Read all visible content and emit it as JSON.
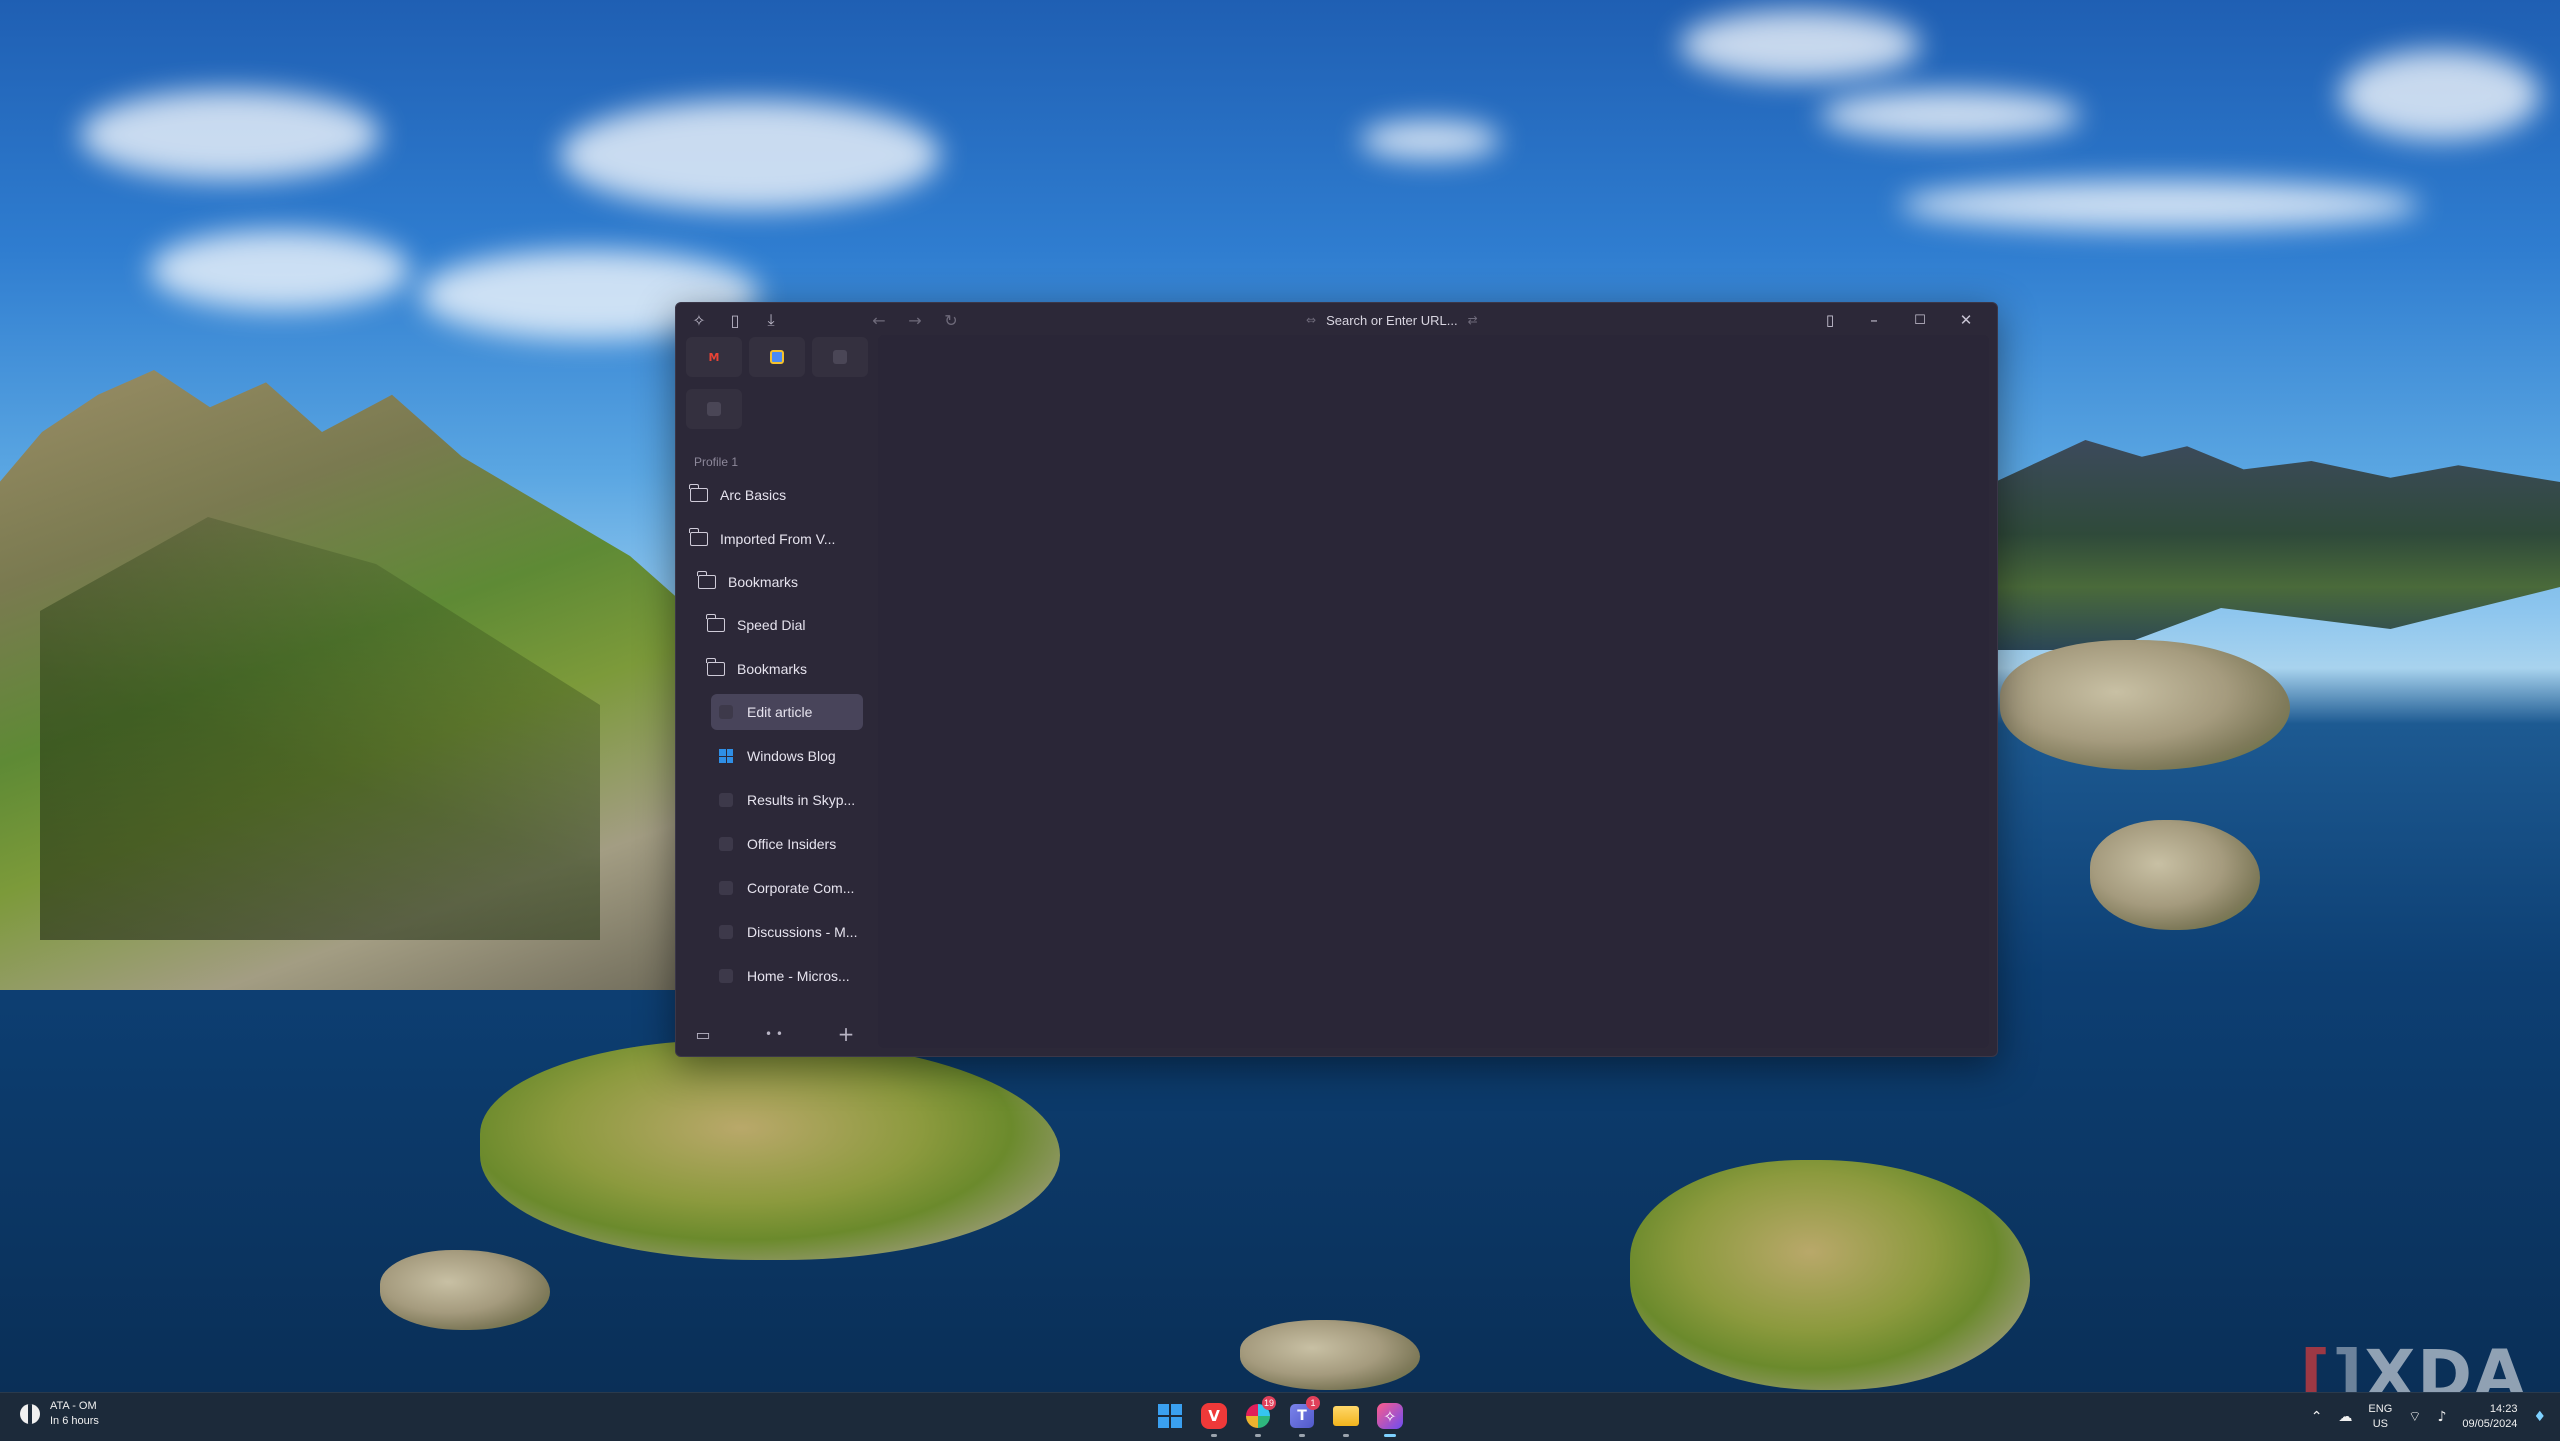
{
  "browser": {
    "url_placeholder": "Search or Enter URL...",
    "profile_label": "Profile 1",
    "pinned_tiles": [
      {
        "icon": "gmail-icon",
        "color": "#ea4335"
      },
      {
        "icon": "google-meet-icon",
        "color": "#4a8af4"
      },
      {
        "icon": "blank-tile-icon",
        "color": "#4a4656"
      },
      {
        "icon": "blank-tile-icon",
        "color": "#4a4656"
      }
    ],
    "sidebar_items": [
      {
        "label": "Arc Basics",
        "type": "folder"
      },
      {
        "label": "Imported From V...",
        "type": "folder"
      },
      {
        "label": "Bookmarks",
        "type": "folder"
      },
      {
        "label": "Speed Dial",
        "type": "folder"
      },
      {
        "label": "Bookmarks",
        "type": "folder"
      },
      {
        "label": "Edit article",
        "type": "page",
        "selected": true
      },
      {
        "label": "Windows Blog",
        "type": "page",
        "icon": "windows-logo-icon"
      },
      {
        "label": "Results in Skyp...",
        "type": "page"
      },
      {
        "label": "Office Insiders",
        "type": "page"
      },
      {
        "label": "Corporate Com...",
        "type": "page"
      },
      {
        "label": "Discussions - M...",
        "type": "page"
      },
      {
        "label": "Home - Micros...",
        "type": "page"
      }
    ]
  },
  "taskbar": {
    "weather_title": "ATA - OM",
    "weather_subtitle": "In 6 hours",
    "apps": [
      {
        "icon": "windows-start-icon"
      },
      {
        "icon": "vivaldi-icon"
      },
      {
        "icon": "slack-icon",
        "badge": "19"
      },
      {
        "icon": "teams-icon",
        "badge": "1"
      },
      {
        "icon": "file-explorer-icon"
      },
      {
        "icon": "arc-icon"
      }
    ],
    "language": "ENG",
    "region": "US",
    "time": "14:23",
    "date": "09/05/2024"
  },
  "watermark": "XDA"
}
